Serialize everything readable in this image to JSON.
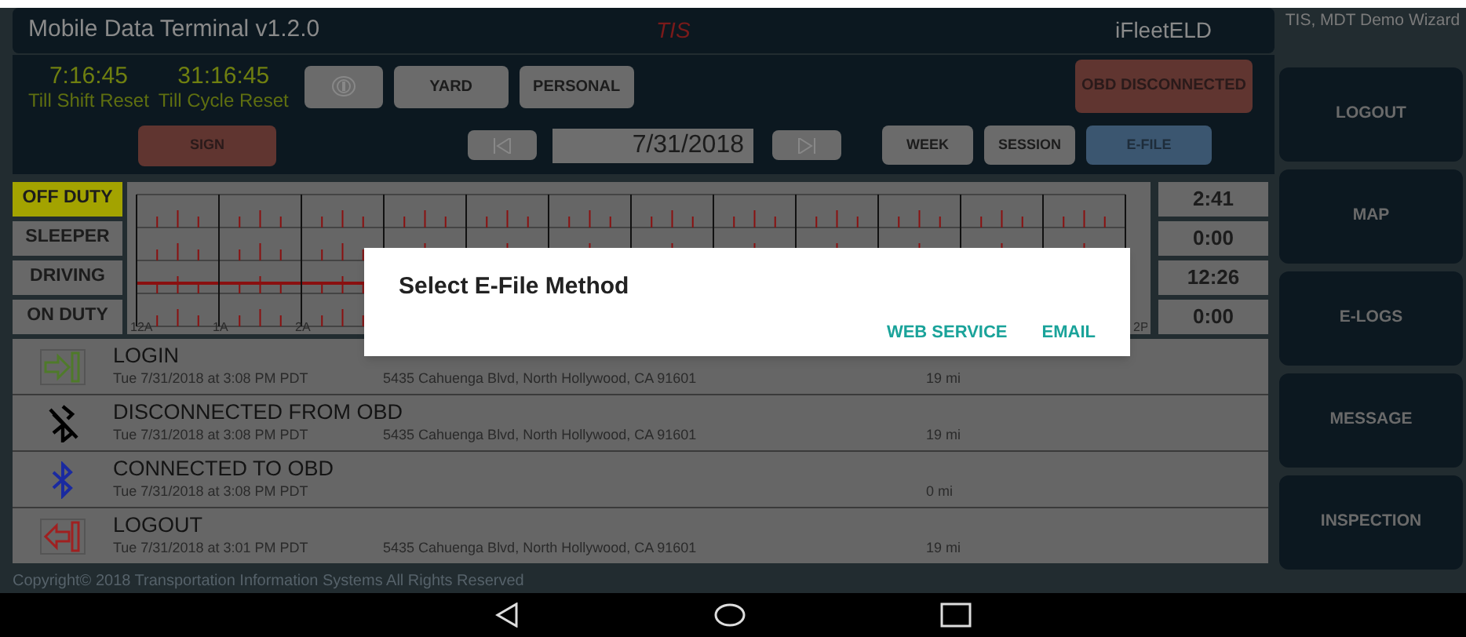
{
  "header": {
    "title": "Mobile Data Terminal v1.2.0",
    "brand": "TIS",
    "app": "iFleetELD"
  },
  "user": "TIS, MDT Demo Wizard",
  "timers": [
    {
      "value": "7:16:45",
      "label": "Till Shift Reset"
    },
    {
      "value": "31:16:45",
      "label": "Till Cycle Reset"
    }
  ],
  "status_buttons": [
    {
      "kind": "icon"
    },
    {
      "kind": "text",
      "label": "YARD"
    },
    {
      "kind": "text",
      "label": "PERSONAL"
    }
  ],
  "obd_status": "OBD DISCONNECTED",
  "sign_button": "SIGN",
  "date": "7/31/2018",
  "view_buttons": [
    {
      "label": "WEEK",
      "selected": false
    },
    {
      "label": "SESSION",
      "selected": false
    },
    {
      "label": "E-FILE",
      "selected": true
    }
  ],
  "duty_rows": [
    {
      "label": "OFF DUTY",
      "selected": true,
      "total": "2:41",
      "line": false
    },
    {
      "label": "SLEEPER",
      "selected": false,
      "total": "0:00",
      "line": false
    },
    {
      "label": "DRIVING",
      "selected": false,
      "total": "12:26",
      "line": true
    },
    {
      "label": "ON DUTY",
      "selected": false,
      "total": "0:00",
      "line": false
    }
  ],
  "hour_labels": [
    {
      "label": "12A",
      "kind": "hour"
    },
    {
      "label": "1A",
      "kind": "hour"
    },
    {
      "label": "2A",
      "kind": "hour"
    },
    {
      "label": "2P",
      "kind": "end"
    }
  ],
  "log": [
    {
      "kind": "login",
      "title": "LOGIN",
      "time": "Tue 7/31/2018 at 3:08 PM PDT",
      "address": "5435 Cahuenga Blvd, North Hollywood, CA 91601",
      "distance": "19 mi"
    },
    {
      "kind": "disconnected",
      "title": "DISCONNECTED FROM OBD",
      "time": "Tue 7/31/2018 at 3:08 PM PDT",
      "address": "5435 Cahuenga Blvd, North Hollywood, CA 91601",
      "distance": "19 mi"
    },
    {
      "kind": "connected",
      "title": "CONNECTED TO OBD",
      "time": "Tue 7/31/2018 at 3:08 PM PDT",
      "distance": "0 mi"
    },
    {
      "kind": "logout",
      "title": "LOGOUT",
      "time": "Tue 7/31/2018 at 3:01 PM PDT",
      "address": "5435 Cahuenga Blvd, North Hollywood, CA 91601",
      "distance": "19 mi"
    }
  ],
  "sidebar": [
    "LOGOUT",
    "MAP",
    "E-LOGS",
    "MESSAGE",
    "INSPECTION"
  ],
  "copyright": "Copyright© 2018 Transportation Information Systems All Rights Reserved",
  "dialog": {
    "title": "Select E-File Method",
    "actions": [
      "WEB SERVICE",
      "EMAIL"
    ]
  }
}
